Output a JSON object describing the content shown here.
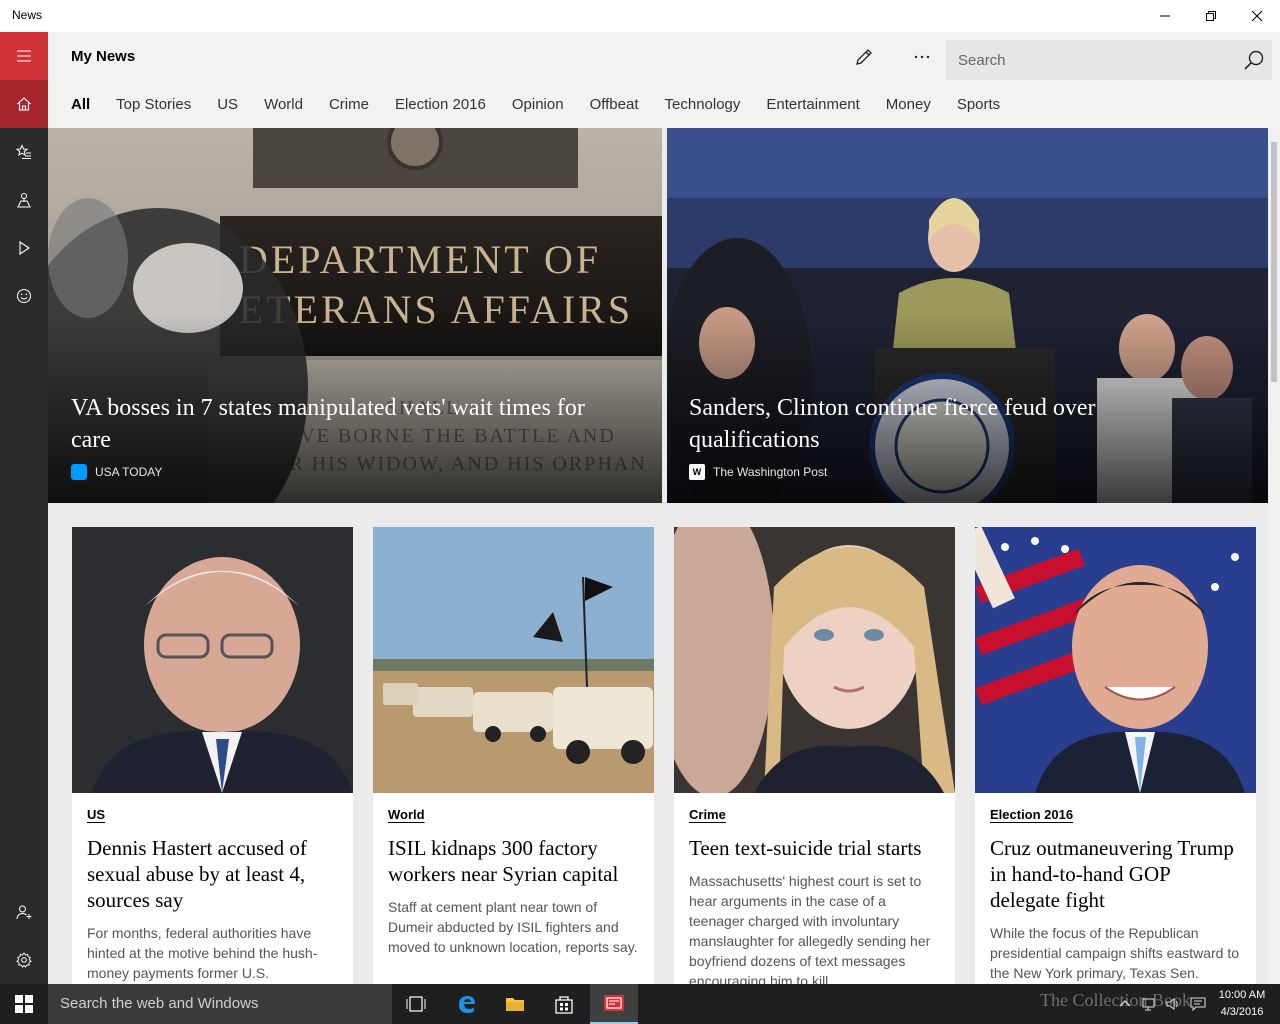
{
  "window": {
    "title": "News"
  },
  "header": {
    "page_title": "My News",
    "search_placeholder": "Search"
  },
  "tabs": [
    {
      "label": "All",
      "active": true
    },
    {
      "label": "Top Stories"
    },
    {
      "label": "US"
    },
    {
      "label": "World"
    },
    {
      "label": "Crime"
    },
    {
      "label": "Election 2016"
    },
    {
      "label": "Opinion"
    },
    {
      "label": "Offbeat"
    },
    {
      "label": "Technology"
    },
    {
      "label": "Entertainment"
    },
    {
      "label": "Money"
    },
    {
      "label": "Sports"
    }
  ],
  "hero": [
    {
      "headline": "VA bosses in 7 states manipulated vets' wait times for care",
      "source": "USA TODAY",
      "image_text": "DEPARTMENT OF VETERANS AFFAIRS"
    },
    {
      "headline": "Sanders, Clinton continue fierce feud over qualifications",
      "source": "The Washington Post"
    }
  ],
  "cards": [
    {
      "category": "US",
      "title": "Dennis Hastert accused of sexual abuse by at least 4, sources say",
      "summary": "For months, federal authorities have hinted at the motive behind the hush-money payments former U.S."
    },
    {
      "category": "World",
      "title": "ISIL kidnaps 300 factory workers near Syrian capital",
      "summary": "Staff at cement plant near town of Dumeir abducted by ISIL fighters and moved to unknown location, reports say."
    },
    {
      "category": "Crime",
      "title": "Teen text-suicide trial starts",
      "summary": "Massachusetts' highest court is set to hear arguments in the case of a teenager charged with involuntary manslaughter for allegedly sending her boyfriend dozens of text messages encouraging him to kill"
    },
    {
      "category": "Election 2016",
      "title": "Cruz outmaneuvering Trump in hand-to-hand GOP delegate fight",
      "summary": "While the focus of the Republican presidential campaign shifts eastward to the New York primary, Texas Sen."
    }
  ],
  "taskbar": {
    "search_placeholder": "Search the web and Windows",
    "time": "10:00 AM",
    "date": "4/3/2016",
    "watermark": "The Collection Book"
  },
  "colors": {
    "accent": "#d13438",
    "accent_dark": "#a4262c",
    "rail": "#2b2b2b",
    "taskbar": "#1f1f1f"
  },
  "icons": {
    "rail": [
      "hamburger-icon",
      "home-icon",
      "favorites-icon",
      "local-icon",
      "video-icon",
      "smiley-icon",
      "account-icon",
      "settings-icon"
    ],
    "header": [
      "edit-pencil-icon",
      "more-icon",
      "search-icon"
    ]
  }
}
